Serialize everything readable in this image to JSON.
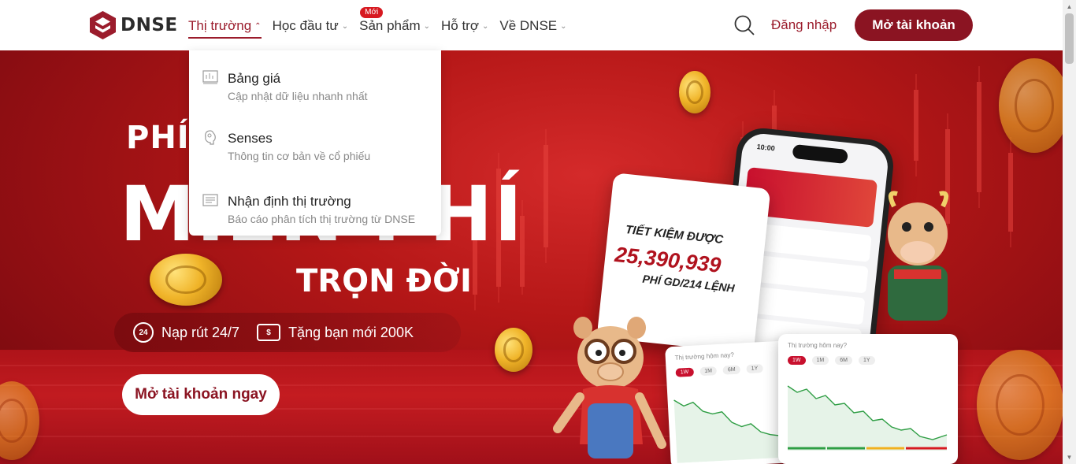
{
  "brand": {
    "name": "DNSE"
  },
  "nav": {
    "items": [
      {
        "label": "Thị trường",
        "active": true
      },
      {
        "label": "Học đầu tư",
        "active": false
      },
      {
        "label": "Sản phẩm",
        "active": false,
        "badge": "Mới"
      },
      {
        "label": "Hỗ trợ",
        "active": false
      },
      {
        "label": "Về DNSE",
        "active": false
      }
    ],
    "login_label": "Đăng nhập",
    "open_account_label": "Mở tài khoản"
  },
  "dropdown": {
    "items": [
      {
        "title": "Bảng giá",
        "desc": "Cập nhật dữ liệu nhanh nhất",
        "icon": "price-board-icon"
      },
      {
        "title": "Senses",
        "desc": "Thông tin cơ bản về cổ phiếu",
        "icon": "brain-icon"
      },
      {
        "title": "Nhận định thị trường",
        "desc": "Báo cáo phân tích thị trường từ DNSE",
        "icon": "report-icon"
      }
    ]
  },
  "hero": {
    "title_top": "PHÍ",
    "title_main": "MIỄN PHÍ",
    "title_bottom": "TRỌN ĐỜI",
    "features": [
      {
        "icon_text": "24",
        "label": "Nạp rút 24/7"
      },
      {
        "icon_text": "$",
        "label": "Tặng bạn mới 200K"
      }
    ],
    "cta_label": "Mở tài khoản ngay",
    "savings": {
      "label": "TIẾT KIỆM ĐƯỢC",
      "value": "25,390,939",
      "sub": "PHÍ GD/214 LỆNH"
    },
    "phone": {
      "time": "10:00"
    },
    "chart_card": {
      "title": "Thị trường hôm nay?",
      "tabs": [
        "1W",
        "1M",
        "6M",
        "1Y"
      ]
    }
  },
  "colors": {
    "brand": "#8b1422",
    "accent": "#9b1c2c",
    "badge": "#d71920"
  }
}
